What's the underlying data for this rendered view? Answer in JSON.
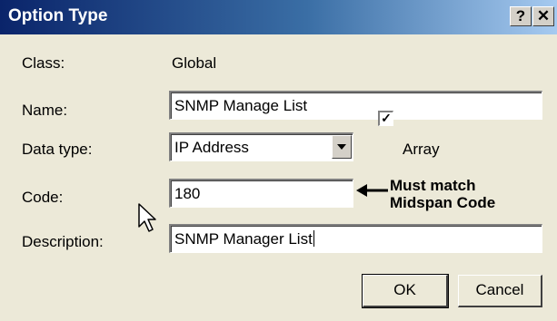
{
  "window": {
    "title": "Option Type",
    "help_glyph": "?",
    "close_glyph": "✕"
  },
  "form": {
    "class_label": "Class:",
    "class_value": "Global",
    "name_label": "Name:",
    "name_value": "SNMP Manage List",
    "datatype_label": "Data type:",
    "datatype_value": "IP Address",
    "array_label": "Array",
    "array_checked": true,
    "code_label": "Code:",
    "code_value": "180",
    "description_label": "Description:",
    "description_value": "SNMP Manager List"
  },
  "annotation": {
    "line1": "Must match",
    "line2": "Midspan Code"
  },
  "buttons": {
    "ok": "OK",
    "cancel": "Cancel"
  },
  "icons": {
    "help": "help-icon",
    "close": "close-icon",
    "dropdown": "chevron-down-icon",
    "check": "checkmark-icon",
    "arrow": "arrow-left-icon",
    "cursor": "mouse-pointer-icon"
  }
}
